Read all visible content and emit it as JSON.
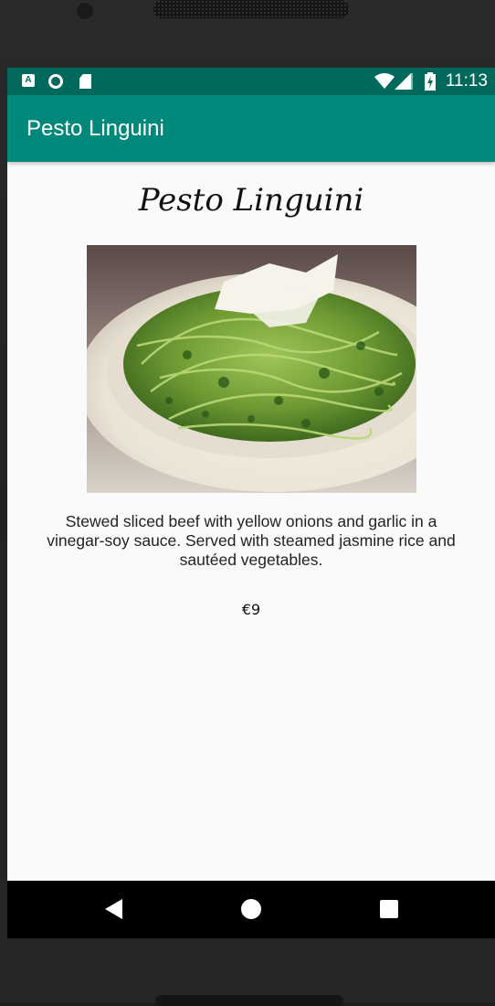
{
  "status_bar": {
    "time": "11:13",
    "icons": [
      "a-notification-icon",
      "circle-notification-icon",
      "sd-card-icon",
      "wifi-icon",
      "cell-signal-icon",
      "battery-charging-icon"
    ]
  },
  "app_bar": {
    "title": "Pesto Linguini",
    "color": "#00897b",
    "status_color": "#00695c"
  },
  "dish": {
    "heading": "Pesto Linguini",
    "image": "pesto-linguini-plate",
    "description": "Stewed sliced beef with yellow onions and garlic in a vinegar-soy sauce. Served with steamed jasmine rice and sautéed vegetables.",
    "price": "€9"
  },
  "nav_bar": {
    "buttons": [
      "back",
      "home",
      "recents"
    ]
  }
}
